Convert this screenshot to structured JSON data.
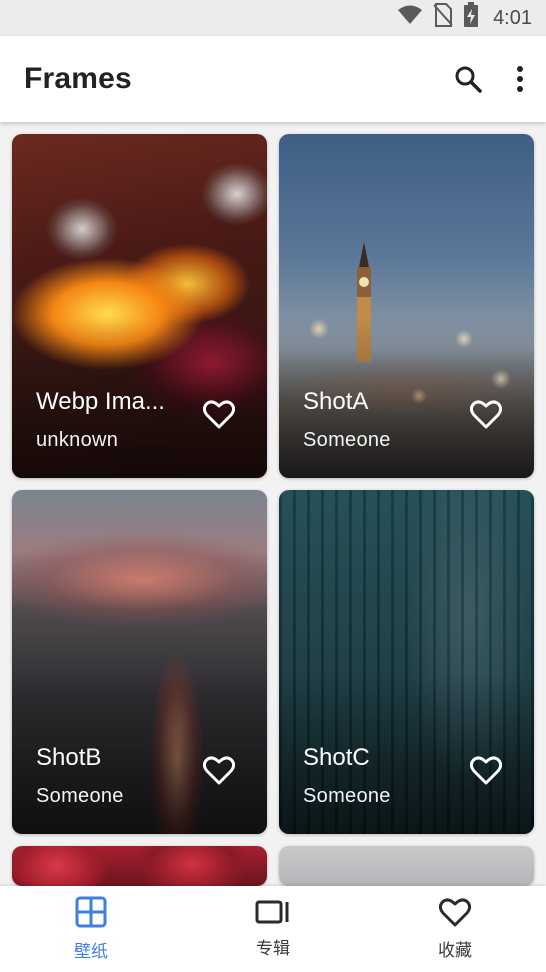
{
  "status_bar": {
    "time": "4:01",
    "icons": [
      "wifi-icon",
      "no-sim-icon",
      "battery-charging-icon"
    ]
  },
  "app_bar": {
    "title": "Frames",
    "actions": [
      "search-icon",
      "more-vert-icon"
    ]
  },
  "wallpapers": [
    {
      "title": "Webp Ima...",
      "author": "unknown",
      "favorite": false
    },
    {
      "title": "ShotA",
      "author": "Someone",
      "favorite": false
    },
    {
      "title": "ShotB",
      "author": "Someone",
      "favorite": false
    },
    {
      "title": "ShotC",
      "author": "Someone",
      "favorite": false
    }
  ],
  "bottom_nav": {
    "items": [
      {
        "label": "壁纸",
        "icon": "grid-icon",
        "active": true
      },
      {
        "label": "专辑",
        "icon": "collections-icon",
        "active": false
      },
      {
        "label": "收藏",
        "icon": "heart-icon",
        "active": false
      }
    ]
  },
  "colors": {
    "accent": "#3d7ee0",
    "app_bar_bg": "#ffffff",
    "background": "#f2f2f2",
    "status_bar_bg": "#ececec"
  }
}
